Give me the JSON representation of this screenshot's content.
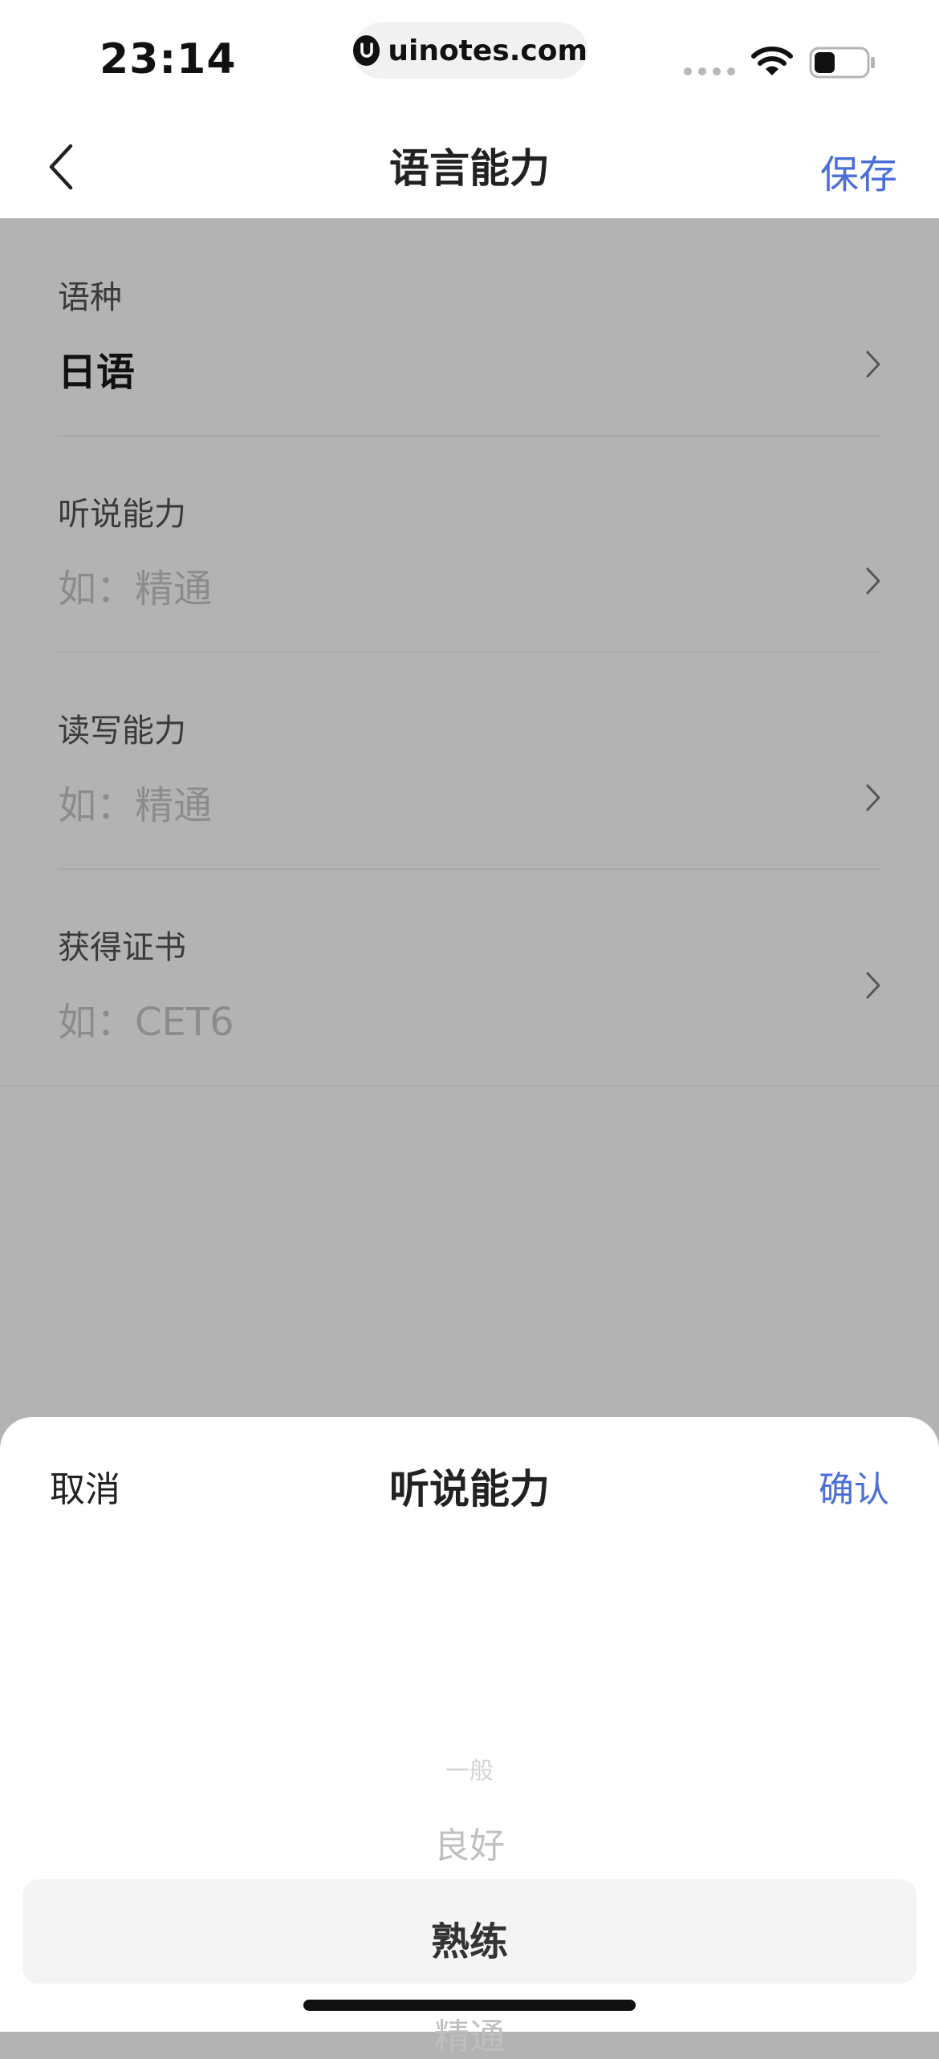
{
  "status_bar": {
    "time": "23:14",
    "url": "uinotes.com",
    "wifi_icon": "wifi-icon",
    "battery_icon": "battery-icon",
    "battery_level": 0.4
  },
  "nav": {
    "back_icon": "chevron-left-icon",
    "title": "语言能力",
    "save_label": "保存"
  },
  "form": {
    "rows": [
      {
        "label": "语种",
        "value": "日语",
        "filled": true
      },
      {
        "label": "听说能力",
        "placeholder": "如：精通",
        "filled": false
      },
      {
        "label": "读写能力",
        "placeholder": "如：精通",
        "filled": false
      },
      {
        "label": "获得证书",
        "placeholder": "如：CET6",
        "filled": false
      }
    ]
  },
  "sheet": {
    "cancel_label": "取消",
    "title": "听说能力",
    "confirm_label": "确认",
    "options": [
      "一般",
      "良好",
      "熟练",
      "精通"
    ],
    "selected": "熟练"
  },
  "colors": {
    "accent": "#4a6fd8",
    "overlay": "#b3b3b3",
    "picker_highlight": "#f4f4f4"
  }
}
